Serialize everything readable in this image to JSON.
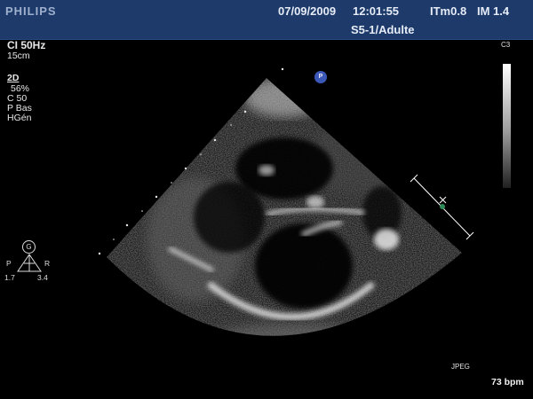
{
  "header": {
    "brand": "PHILIPS",
    "date": "07/09/2009",
    "time": "12:01:55",
    "thermal_index": "ITm0.8",
    "mechanical_index": "IM 1.4",
    "probe_preset": "S5-1/Adulte"
  },
  "left_panel": {
    "frame_rate": "CI 50Hz",
    "depth": "15cm",
    "mode": "2D",
    "gain": "56%",
    "compression": "C 50",
    "power": "P Bas",
    "harmonics": "HGén"
  },
  "orientation": {
    "center_label": "G",
    "left_label": "P",
    "right_label": "R",
    "left_value": "1.7",
    "right_value": "3.4"
  },
  "marker": {
    "label": "P"
  },
  "right_panel": {
    "map_label": "C3",
    "format_label": "JPEG",
    "heart_rate": "73 bpm"
  },
  "colors": {
    "header_bg": "#1d3a6a",
    "marker": "#3b58b8",
    "caliper": "#ffffff",
    "caliper_point": "#2e8b57"
  }
}
